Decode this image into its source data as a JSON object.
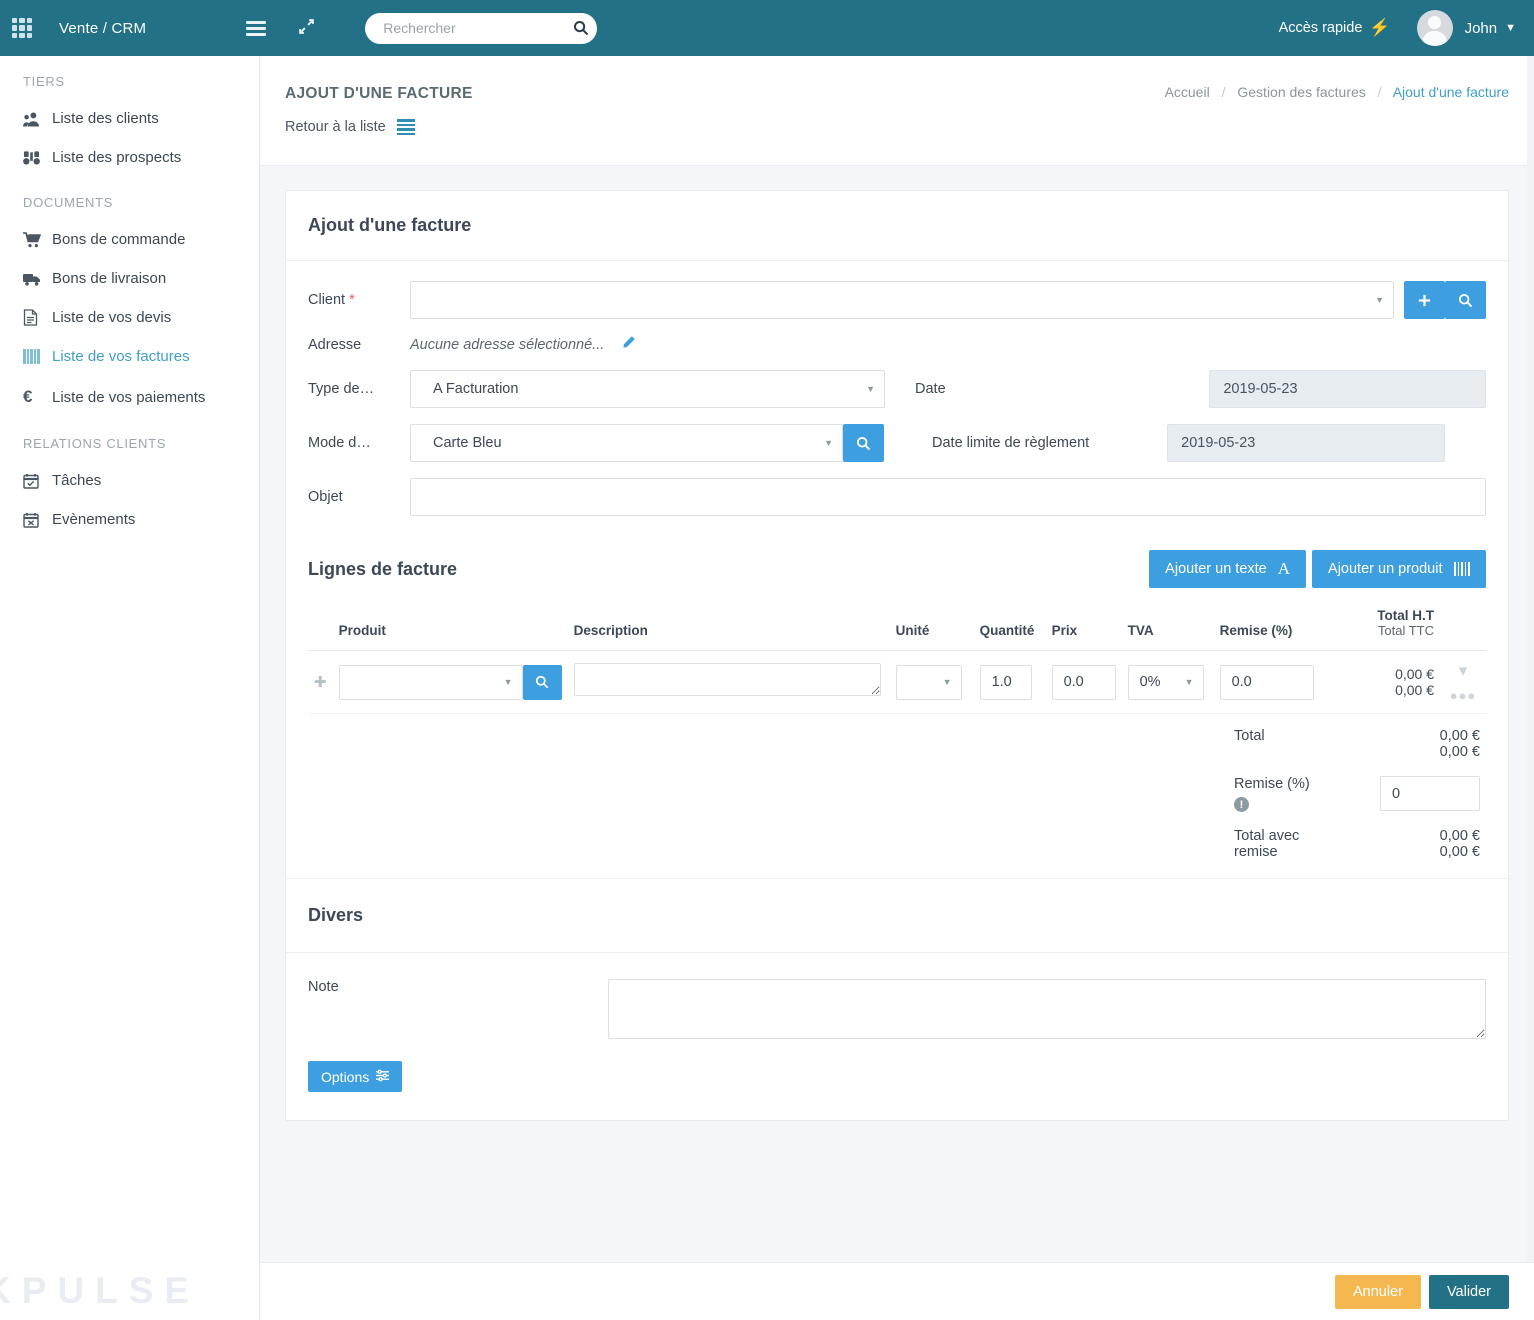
{
  "topbar": {
    "apps_icon": "grid-apps-icon",
    "brand": "Vente / CRM",
    "menu_icon": "hamburger-icon",
    "expand_icon": "expand-arrows-icon",
    "search_placeholder": "Rechercher",
    "search_value": "",
    "search_icon": "search-icon",
    "quick_access": "Accès rapide",
    "bolt_icon": "lightning-bolt-icon",
    "user_name": "John",
    "chevron_icon": "chevron-down-icon",
    "bg_color": "#227186"
  },
  "sidebar": {
    "sections": [
      {
        "title": "TIERS",
        "items": [
          {
            "label": "Liste des clients",
            "icon": "users-icon",
            "glyph": "♟",
            "active": false
          },
          {
            "label": "Liste des prospects",
            "icon": "binoculars-icon",
            "glyph": "♀",
            "active": false
          }
        ]
      },
      {
        "title": "DOCUMENTS",
        "items": [
          {
            "label": "Bons de commande",
            "icon": "shopping-cart-icon",
            "glyph": "⛉",
            "active": false
          },
          {
            "label": "Bons de livraison",
            "icon": "truck-icon",
            "glyph": "⛟",
            "active": false
          },
          {
            "label": "Liste de vos devis",
            "icon": "document-icon",
            "glyph": "☰",
            "active": false
          },
          {
            "label": "Liste de vos factures",
            "icon": "barcode-icon",
            "glyph": "",
            "active": true
          },
          {
            "label": "Liste de vos paiements",
            "icon": "euro-icon",
            "glyph": "€",
            "active": false
          }
        ]
      },
      {
        "title": "RELATIONS CLIENTS",
        "items": [
          {
            "label": "Tâches",
            "icon": "calendar-check-icon",
            "glyph": "☑",
            "active": false
          },
          {
            "label": "Evènements",
            "icon": "calendar-x-icon",
            "glyph": "☒",
            "active": false
          }
        ]
      }
    ],
    "watermark": "KPULSE"
  },
  "page": {
    "title": "AJOUT D'UNE FACTURE",
    "breadcrumb": [
      "Accueil",
      "Gestion des factures",
      "Ajout d'une facture"
    ],
    "back_label": "Retour à la liste",
    "back_icon": "list-icon"
  },
  "form": {
    "card_title": "Ajout d'une facture",
    "client_label": "Client",
    "client_required": "*",
    "client_value": "",
    "client_add_icon": "plus-icon",
    "client_search_icon": "search-icon",
    "address_label": "Adresse",
    "address_value": "Aucune adresse sélectionné...",
    "address_edit_icon": "pencil-icon",
    "type_label": "Type de…",
    "type_value": "A Facturation",
    "date_label": "Date",
    "date_value": "2019-05-23",
    "mode_label": "Mode d…",
    "mode_value": "Carte Bleu",
    "mode_search_icon": "search-icon",
    "duedate_label": "Date limite de règlement",
    "duedate_value": "2019-05-23",
    "objet_label": "Objet",
    "objet_value": ""
  },
  "lines": {
    "title": "Lignes de facture",
    "add_text_btn": "Ajouter un texte",
    "add_text_icon": "font-a-icon",
    "add_product_btn": "Ajouter un produit",
    "add_product_icon": "barcode-icon",
    "columns": {
      "produit": "Produit",
      "description": "Description",
      "unite": "Unité",
      "quantite": "Quantité",
      "prix": "Prix",
      "tva": "TVA",
      "remise": "Remise (%)",
      "total_ht": "Total H.T",
      "total_ttc": "Total TTC"
    },
    "rows": [
      {
        "drag_icon": "drag-handle-icon",
        "produit": "",
        "produit_search_icon": "search-icon",
        "description": "",
        "unite": "",
        "quantite": "1.0",
        "prix": "0.0",
        "tva": "0%",
        "remise": "0.0",
        "total_ht": "0,00 €",
        "total_ttc": "0,00 €",
        "expand_icon": "chevron-down-icon",
        "more_icon": "ellipsis-icon"
      }
    ],
    "summary": {
      "total_label": "Total",
      "total_ht": "0,00 €",
      "total_ttc": "0,00 €",
      "remise_label": "Remise (%)",
      "remise_info_icon": "info-icon",
      "remise_value": "0",
      "total_remise_label": "Total avec remise",
      "total_remise_ht": "0,00 €",
      "total_remise_ttc": "0,00 €"
    }
  },
  "divers": {
    "title": "Divers",
    "note_label": "Note",
    "note_value": "",
    "options_btn": "Options",
    "options_icon": "sliders-icon"
  },
  "footer": {
    "cancel": "Annuler",
    "validate": "Valider",
    "cancel_color": "#f5b74f",
    "validate_color": "#227186"
  }
}
